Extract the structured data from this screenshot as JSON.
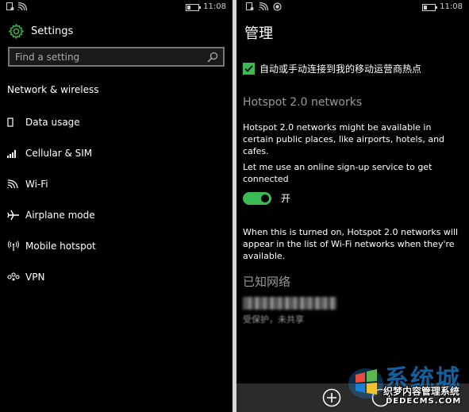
{
  "left": {
    "status": {
      "time": "11:08"
    },
    "header": {
      "title": "Settings"
    },
    "search": {
      "placeholder": "Find a setting"
    },
    "section": "Network & wireless",
    "items": [
      {
        "label": "Data usage",
        "icon": "data-usage-icon"
      },
      {
        "label": "Cellular & SIM",
        "icon": "cellular-icon"
      },
      {
        "label": "Wi-Fi",
        "icon": "wifi-icon"
      },
      {
        "label": "Airplane mode",
        "icon": "airplane-icon"
      },
      {
        "label": "Mobile hotspot",
        "icon": "hotspot-icon"
      },
      {
        "label": "VPN",
        "icon": "vpn-icon"
      }
    ]
  },
  "right": {
    "status": {
      "time": "11:08"
    },
    "title": "管理",
    "checkbox_label": "自动或手动连接到我的移动运营商热点",
    "hotspot_header": "Hotspot 2.0 networks",
    "hotspot_desc": "Hotspot 2.0 networks might be available in certain public places, like airports, hotels, and cafes.",
    "signup_label": "Let me use an online sign-up service to get connected",
    "toggle_state": "开",
    "turned_on_desc": "When this is turned on, Hotspot 2.0 networks will appear in the list of Wi-Fi networks when they're available.",
    "known_networks": "已知网络",
    "known_network_sub": "受保护，未共享"
  },
  "watermark": {
    "big": "系统城",
    "cn": "织梦内容管理系统",
    "en": "DEDECMS.COM"
  },
  "colors": {
    "accent": "#3cba54",
    "background": "#000000",
    "appbar": "#2b2b2b",
    "watermark_blue": "#1c7fd1"
  }
}
